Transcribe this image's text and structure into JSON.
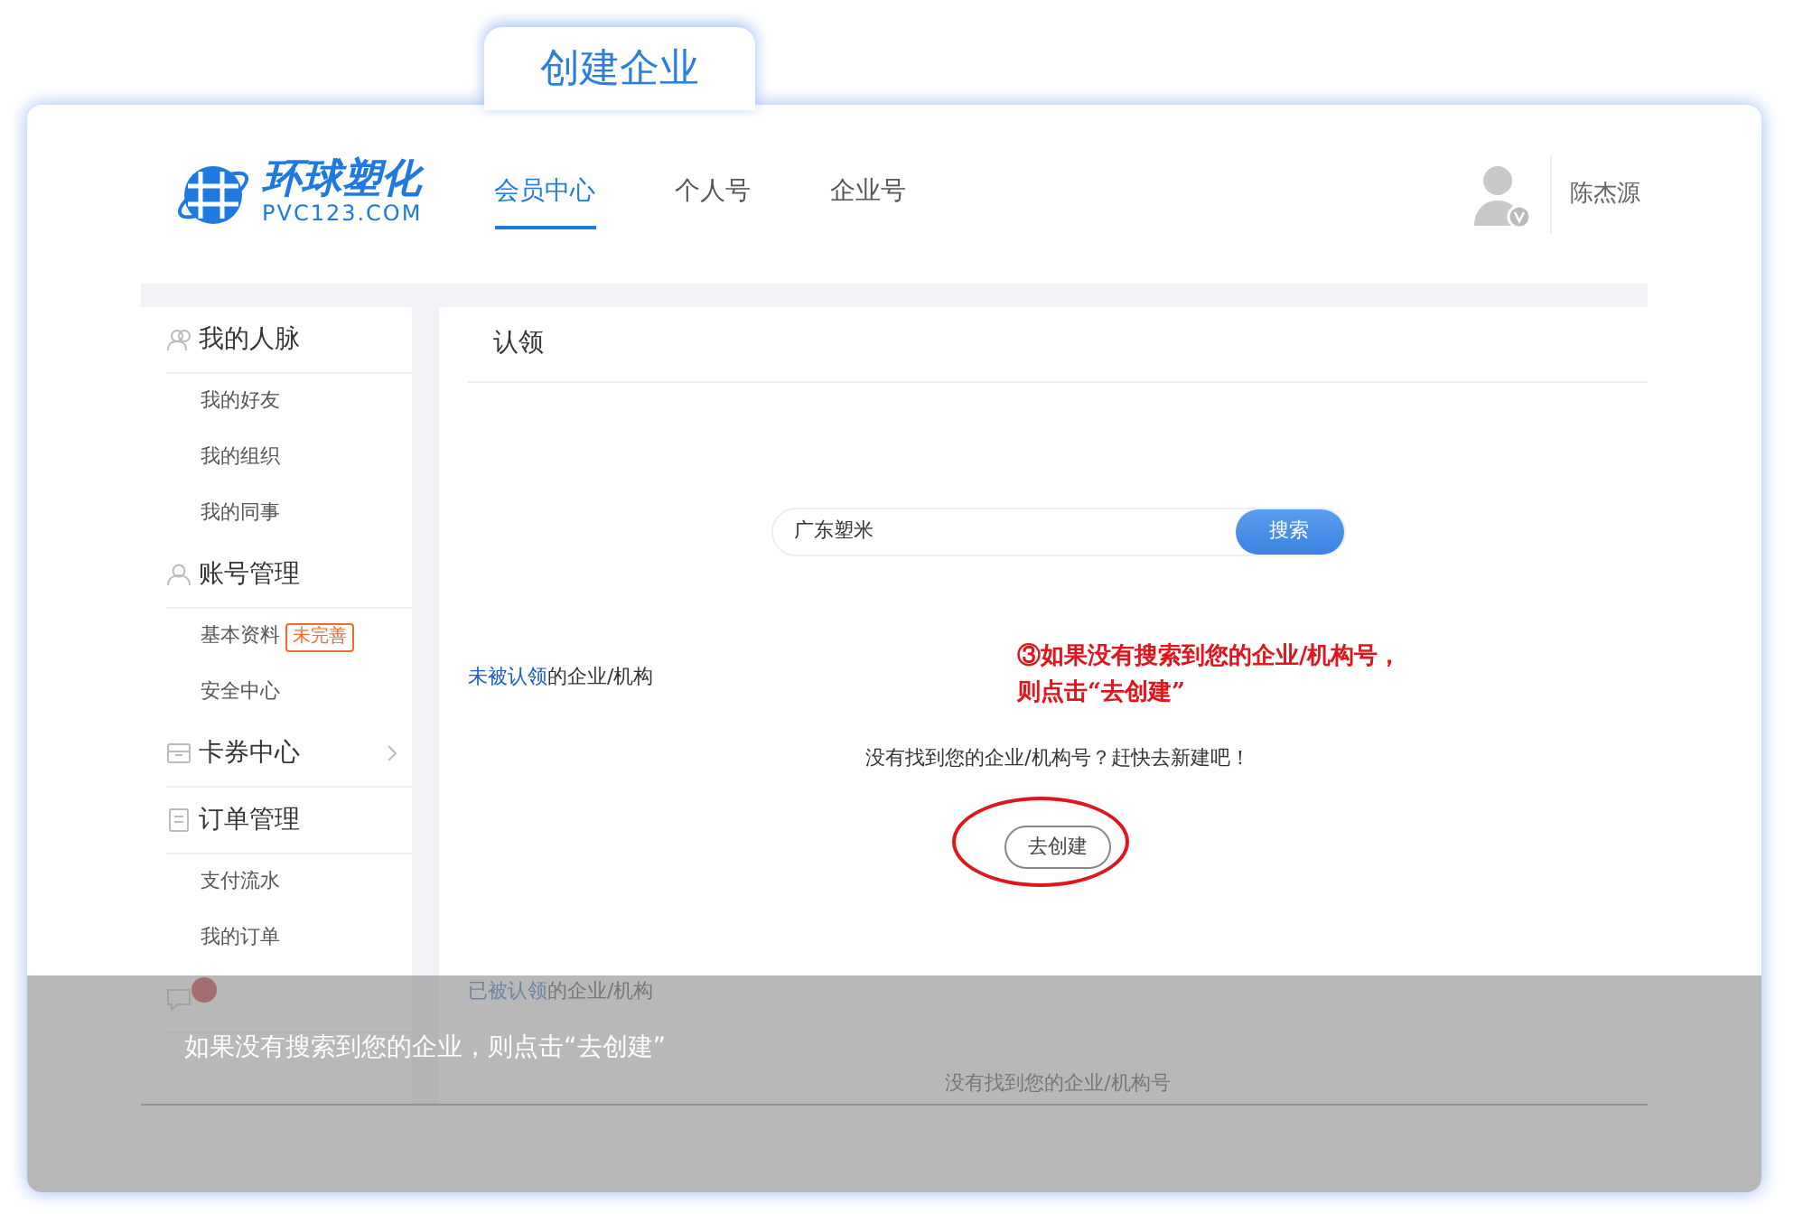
{
  "header_tab": {
    "label": "创建企业"
  },
  "logo": {
    "name": "环球塑化",
    "domain": "PVC123.COM"
  },
  "nav": [
    {
      "label": "会员中心",
      "selected": true
    },
    {
      "label": "个人号",
      "selected": false
    },
    {
      "label": "企业号",
      "selected": false
    }
  ],
  "user": {
    "name": "陈杰源"
  },
  "sidebar": [
    {
      "kind": "people",
      "title": "我的人脉",
      "items": [
        {
          "label": "我的好友"
        },
        {
          "label": "我的组织"
        },
        {
          "label": "我的同事"
        }
      ]
    },
    {
      "kind": "account",
      "title": "账号管理",
      "items": [
        {
          "label": "基本资料",
          "badge": "未完善"
        },
        {
          "label": "安全中心"
        }
      ]
    },
    {
      "kind": "coupon",
      "title": "卡券中心",
      "expandable": true
    },
    {
      "kind": "order",
      "title": "订单管理",
      "items": [
        {
          "label": "支付流水"
        },
        {
          "label": "我的订单"
        }
      ]
    },
    {
      "kind": "message",
      "alert": true
    }
  ],
  "main": {
    "title": "认领",
    "search": {
      "value": "广东塑米",
      "button": "搜索"
    },
    "unclaimed": {
      "heading_link": "未被认领",
      "heading_rest": "的企业/机构",
      "message": "没有找到您的企业/机构号？赶快去新建吧！",
      "button": "去创建"
    },
    "annotation": [
      "③如果没有搜索到您的企业/机构号，",
      "则点击“去创建”"
    ],
    "claimed": {
      "heading_link": "已被认领",
      "heading_rest": "的企业/机构",
      "message": "没有找到您的企业/机构号"
    }
  },
  "caption": "如果没有搜索到您的企业，则点击“去创建”"
}
